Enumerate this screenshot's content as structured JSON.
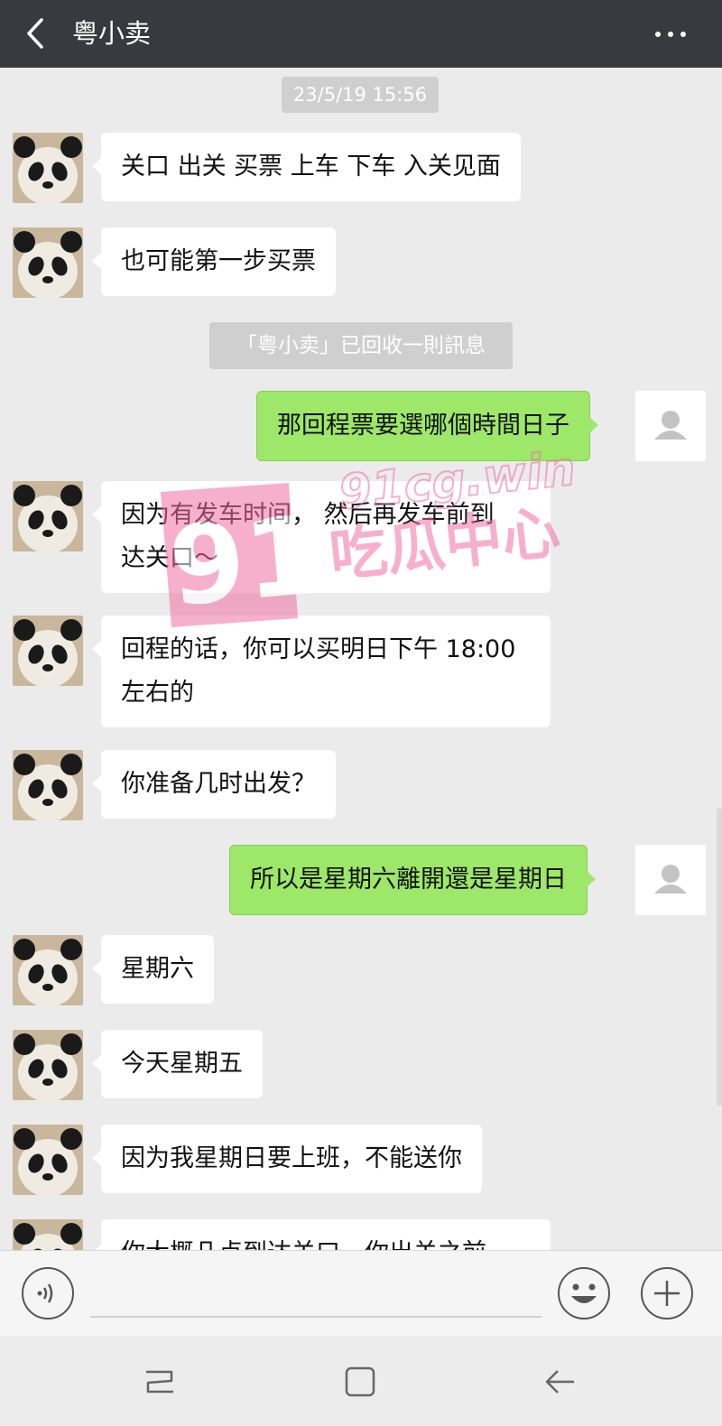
{
  "header": {
    "title": "粤小卖"
  },
  "chat": {
    "timestamp": "23/5/19 15:56",
    "system_notice": "「粤小卖」已回收一則訊息",
    "messages": [
      {
        "side": "in",
        "text": "关口 出关 买票 上车 下车 入关见面"
      },
      {
        "side": "in",
        "text": "也可能第一步买票"
      },
      {
        "side": "out",
        "text": "那回程票要選哪個時間日子"
      },
      {
        "side": "in",
        "line1": "因为有发车时间， 然后再发车前到",
        "line2": "达关口～"
      },
      {
        "side": "in",
        "line1": "回程的话，你可以买明日下午 18:00",
        "line2": "左右的"
      },
      {
        "side": "in",
        "text": "你准备几时出发？"
      },
      {
        "side": "out",
        "text": "所以是星期六離開還是星期日"
      },
      {
        "side": "in",
        "text": "星期六"
      },
      {
        "side": "in",
        "text": "今天星期五"
      },
      {
        "side": "in",
        "text": "因为我星期日要上班，不能送你"
      },
      {
        "side": "in",
        "text": "你大概几点到达关口，你出关之前"
      }
    ]
  },
  "watermark": {
    "number": "91",
    "domain": "91cg.win",
    "label": "吃瓜中心"
  },
  "icons": {
    "back": "chevron-left-icon",
    "more": "more-dots-icon",
    "voice": "voice-icon",
    "emoji": "emoji-icon",
    "plus": "plus-icon",
    "nav_recents": "recents-icon",
    "nav_home": "home-icon",
    "nav_back": "back-arrow-icon"
  },
  "colors": {
    "header_bg": "#393a3f",
    "chat_bg": "#ebebeb",
    "incoming_bubble": "#ffffff",
    "outgoing_bubble": "#9de769",
    "watermark": "#f06fa3"
  }
}
